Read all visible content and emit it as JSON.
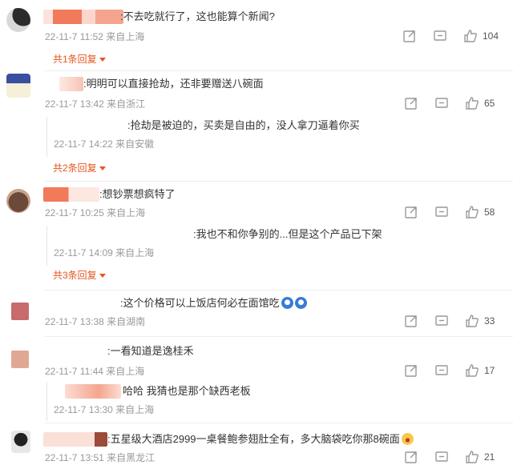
{
  "comments": [
    {
      "text": ":不去吃就行了，这也能算个新闻?",
      "time": "22-11-7 11:52 来自上海",
      "likes": "104",
      "more": "共1条回复"
    },
    {
      "text": ":明明可以直接抢劫，还非要赠送八碗面",
      "time": "22-11-7 13:42 来自浙江",
      "likes": "65",
      "reply_text": ":抢劫是被迫的，买卖是自由的，没人拿刀逼着你买",
      "reply_time": "22-11-7 14:22 来自安徽",
      "more": "共2条回复"
    },
    {
      "text": ":想钞票想疯特了",
      "time": "22-11-7 10:25 来自上海",
      "likes": "58",
      "reply_text": ":我也不和你争别的...但是这个产品已下架",
      "reply_time": "22-11-7 14:09 来自上海",
      "more": "共3条回复"
    },
    {
      "text": ":这个价格可以上饭店何必在面馆吃",
      "time": "22-11-7 13:38 来自湖南",
      "likes": "33"
    },
    {
      "text": ":一看知道是逸桂禾",
      "time": "22-11-7 11:44 来自上海",
      "likes": "17",
      "reply_text": "哈哈 我猜也是那个缺西老板",
      "reply_time": "22-11-7 13:30 来自上海"
    },
    {
      "text": ":五星级大酒店2999一桌餐鲍参翅肚全有，多大脑袋吃你那8碗面",
      "time": "22-11-7 13:51 来自黑龙江",
      "likes": "21"
    }
  ],
  "icons": {
    "share": "share-icon",
    "comment": "comment-icon",
    "like": "thumbs-up-icon",
    "emoji_blue": "doraemon-emoji-icon",
    "emoji_laugh": "laughing-emoji-icon"
  },
  "colors": {
    "accent": "#e6551f",
    "meta": "#999999",
    "text": "#333333"
  }
}
